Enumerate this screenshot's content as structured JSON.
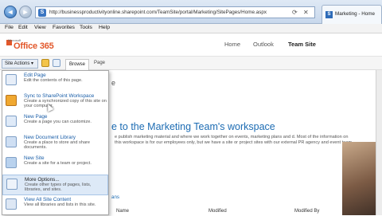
{
  "browser": {
    "url": "http://businessproductivityonline.sharepoint.com/TeamSite/portal/Marketing/SitePages/Home.aspx",
    "tab_title": "Marketing - Home",
    "menu": [
      "File",
      "Edit",
      "View",
      "Favorites",
      "Tools",
      "Help"
    ]
  },
  "header": {
    "logo_small": "Microsoft",
    "logo": "Office 365",
    "nav": [
      "Home",
      "Outlook",
      "Team Site"
    ],
    "active_nav": "Team Site"
  },
  "ribbon": {
    "site_actions": "Site Actions ▾",
    "browse": "Browse",
    "page": "Page"
  },
  "dropdown": {
    "items": [
      {
        "title": "Edit Page",
        "desc": "Edit the contents of this page.",
        "icon": "edit-page-icon"
      },
      {
        "title": "Sync to SharePoint Workspace",
        "desc": "Create a synchronized copy of this site on your computer.",
        "icon": "sync-icon"
      },
      {
        "title": "New Page",
        "desc": "Create a page you can customize.",
        "icon": "new-page-icon"
      },
      {
        "title": "New Document Library",
        "desc": "Create a place to store and share documents.",
        "icon": "document-library-icon"
      },
      {
        "title": "New Site",
        "desc": "Create a site for a team or project.",
        "icon": "new-site-icon"
      },
      {
        "title": "More Options...",
        "desc": "Create other types of pages, lists, libraries, and sites.",
        "icon": "more-options-icon"
      },
      {
        "title": "View All Site Content",
        "desc": "View all libraries and lists in this site.",
        "icon": "site-content-icon"
      }
    ]
  },
  "main": {
    "title": "e to the Marketing Team's workspace",
    "para": "e publish marketing material and where we work together on events, marketing plans and d. Most of the information on this workspace is for our employees only, but we have a site or project sites with our external PR agency and event team.",
    "lib_head": "ans",
    "columns": [
      "Name",
      "Modified",
      "Modified By"
    ]
  }
}
